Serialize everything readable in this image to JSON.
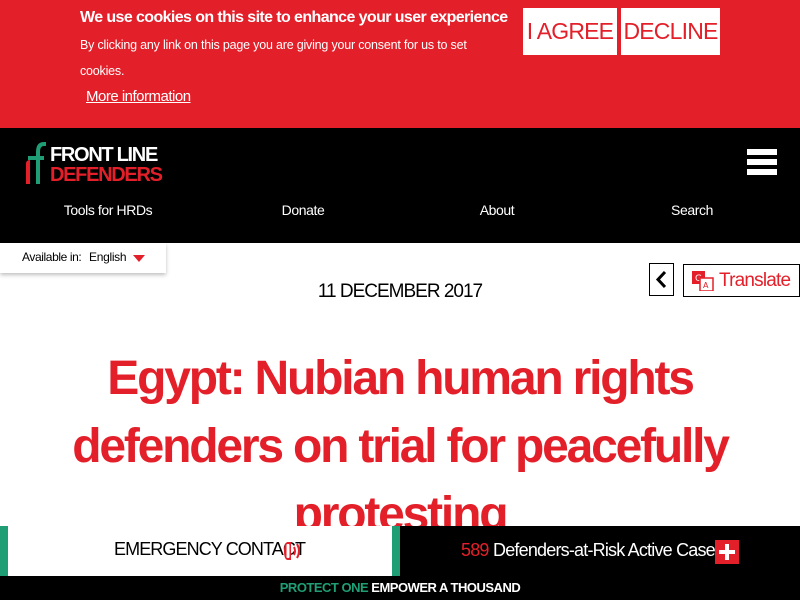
{
  "cookie": {
    "title": "We use cookies on this site to enhance your user experience",
    "text": "By clicking any link on this page you are giving your consent for us to set cookies.",
    "more_link": "More information",
    "agree_label": "I AGREE",
    "decline_label": "DECLINE"
  },
  "logo": {
    "line1": "FRONT LINE",
    "line2": "DEFENDERS"
  },
  "nav": {
    "items": [
      {
        "label": "Tools for HRDs"
      },
      {
        "label": "Donate"
      },
      {
        "label": "About"
      },
      {
        "label": "Search"
      }
    ]
  },
  "language": {
    "label": "Available in:",
    "value": "English"
  },
  "translate": {
    "label": "Translate"
  },
  "article": {
    "date": "11 DECEMBER 2017",
    "headline": "Egypt: Nubian human rights defenders on trial for peacefully protesting"
  },
  "footer_bar": {
    "emergency_label": "EMERGENCY CONTACT",
    "cases_count": "589",
    "cases_label": "Defenders-at-Risk Active Cases",
    "tagline_green": "PROTECT ONE",
    "tagline_white": "EMPOWER A THOUSAND"
  },
  "colors": {
    "brand_red": "#e3202a",
    "accent_green": "#1f9e75",
    "header_black": "#000000"
  },
  "icons": {
    "menu": "hamburger-icon",
    "language_caret": "caret-down-icon",
    "back": "chevron-left-icon",
    "translate": "translate-icon",
    "phone": "phone-ringing-icon",
    "plus": "plus-icon"
  }
}
